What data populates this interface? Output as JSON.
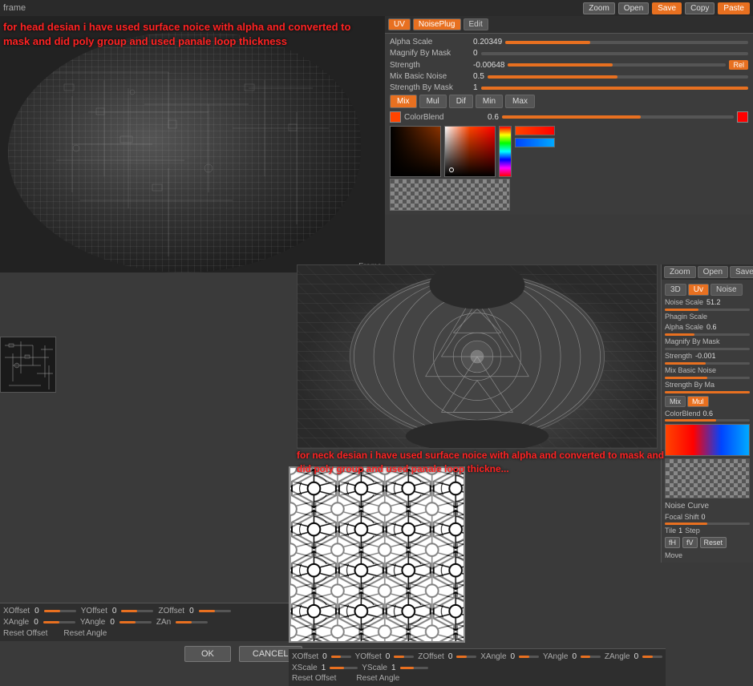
{
  "app": {
    "title": "frame",
    "zoom_label": "Zoom",
    "open_label": "Open",
    "save_label": "Save",
    "copy_label": "Copy",
    "paste_label": "Paste"
  },
  "tabs": {
    "uv_label": "UV",
    "noiseplug_label": "NoisePlug",
    "edit_label": "Edit",
    "threed_label": "3D",
    "uv2_label": "Uv",
    "noise_label": "Noise"
  },
  "noise_panel_top": {
    "alpha_scale_label": "Alpha Scale",
    "alpha_scale_value": "0.20349",
    "magnify_label": "Magnify By Mask",
    "magnify_value": "0",
    "strength_label": "Strength",
    "strength_value": "-0.00648",
    "rel_label": "Rel",
    "mix_basic_label": "Mix Basic Noise",
    "mix_basic_value": "0.5",
    "strength_by_mask_label": "Strength By Mask",
    "strength_by_mask_value": "1",
    "mix_label": "Mix",
    "mul_label": "Mul",
    "dif_label": "Dif",
    "min_label": "Min",
    "max_label": "Max",
    "colorblend_label": "ColorBlend",
    "colorblend_value": "0.6"
  },
  "noise_panel_right": {
    "noise_scale_label": "Noise Scale",
    "noise_scale_value": "51.2",
    "phagin_scale_label": "Phagin Scale",
    "alpha_scale_label": "Alpha Scale",
    "alpha_scale_value": "0.6",
    "magnify_label": "Magnify By Mask",
    "strength_label": "Strength",
    "strength_value": "-0.001",
    "mix_basic_label": "Mix Basic Noise",
    "strength_by_mask_label": "Strength By Ma",
    "mix_label": "Mix",
    "mul_label": "Mul",
    "colorblend_label": "ColorBlend",
    "colorblend_value": "0.6",
    "noise_curve_label": "Noise Curve",
    "focal_shift_label": "Focal Shift",
    "focal_shift_value": "0",
    "tile_label": "Tile",
    "tile_value": "1",
    "step_label": "Step",
    "fh_label": "fH",
    "fv_label": "fV",
    "reset_label": "Reset",
    "move_label": "Move"
  },
  "annotation_head": "for head desian i have used surface noice with alpha and\nconverted to mask and did poly group and used panale loop thickness",
  "annotation_neck": "for neck desian i have used surface noice with alpha and\nconverted to mask and did poly group and used panale loop thickne...",
  "frame_label": "Frame",
  "bottom_controls_left": {
    "xoffset_label": "XOffset",
    "xoffset_value": "0",
    "yoffset_label": "YOffset",
    "yoffset_value": "0",
    "zoffset_label": "ZOffset",
    "zoffset_value": "0",
    "xangle_label": "XAngle",
    "xangle_value": "0",
    "yangle_label": "YAngle",
    "yangle_value": "0",
    "zangle_label": "ZAn",
    "zangle_value": "",
    "reset_offset_label": "Reset Offset",
    "reset_angle_label": "Reset Angle",
    "ok_label": "OK",
    "cancel_label": "CANCEL"
  },
  "bottom_controls_right": {
    "xoffset_label": "XOffset",
    "xoffset_value": "0",
    "yoffset_label": "YOffset",
    "yoffset_value": "0",
    "zoffset_label": "ZOffset",
    "zoffset_value": "0",
    "xangle_label": "XAngle",
    "xangle_value": "0",
    "yangle_label": "YAngle",
    "yangle_value": "0",
    "zangle_label": "ZAngle",
    "zangle_value": "0",
    "xscale_label": "XScale",
    "xscale_value": "1",
    "yscale_label": "YScale",
    "yscale_value": "1",
    "reset_offset_label": "Reset Offset",
    "reset_angle_label": "Reset Angle"
  }
}
